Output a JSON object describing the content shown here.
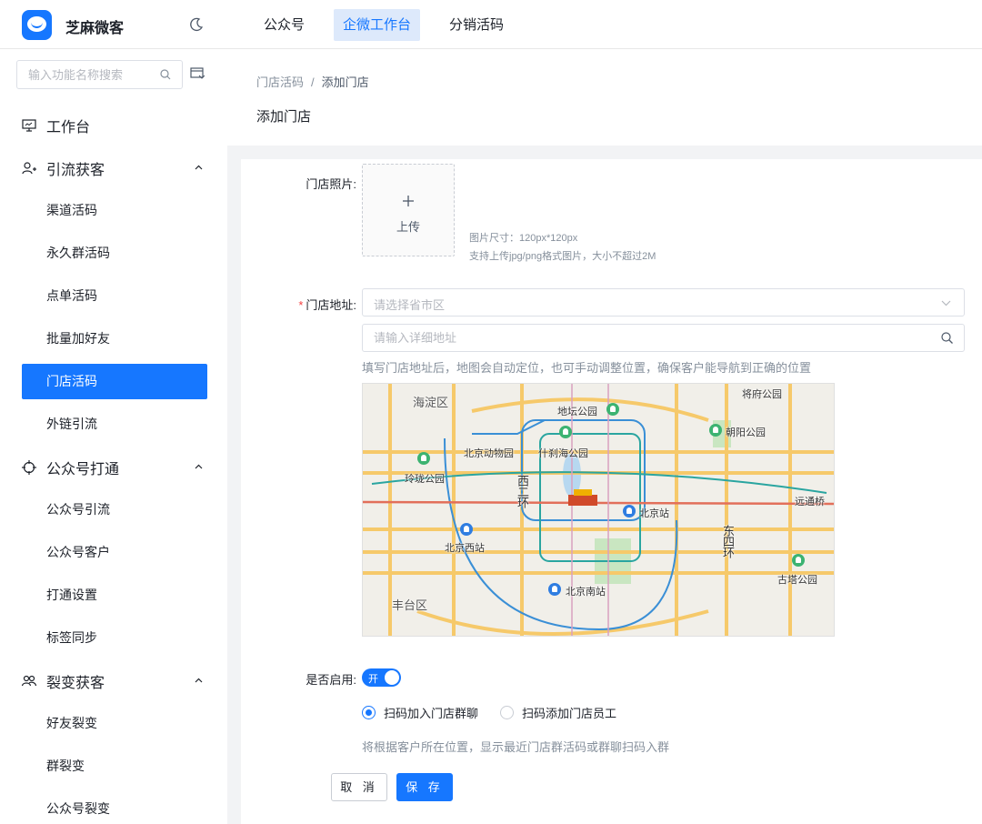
{
  "app": {
    "brand": "芝麻微客"
  },
  "topnav": [
    {
      "label": "公众号"
    },
    {
      "label": "企微工作台"
    },
    {
      "label": "分销活码"
    }
  ],
  "sidebar": {
    "search_placeholder": "输入功能名称搜索",
    "workbench": "工作台",
    "groups": [
      {
        "label": "引流获客",
        "items": [
          "渠道活码",
          "永久群活码",
          "点单活码",
          "批量加好友",
          "门店活码",
          "外链引流"
        ]
      },
      {
        "label": "公众号打通",
        "items": [
          "公众号引流",
          "公众号客户",
          "打通设置",
          "标签同步"
        ]
      },
      {
        "label": "裂变获客",
        "items": [
          "好友裂变",
          "群裂变",
          "公众号裂变"
        ]
      }
    ],
    "active_item": "门店活码"
  },
  "header": {
    "breadcrumb": [
      "门店活码",
      "添加门店"
    ],
    "title": "添加门店"
  },
  "form": {
    "photo_label": "门店照片:",
    "upload_text": "上传",
    "photo_hint_1": "图片尺寸：120px*120px",
    "photo_hint_2": "支持上传jpg/png格式图片，大小不超过2M",
    "address_label": "门店地址:",
    "region_placeholder": "请选择省市区",
    "detail_placeholder": "请输入详细地址",
    "address_hint": "填写门店地址后，地图会自动定位，也可手动调整位置，确保客户能导航到正确的位置",
    "enable_label": "是否启用:",
    "switch_text": "开",
    "switch_on": true,
    "radio_options": [
      "扫码加入门店群聊",
      "扫码添加门店员工"
    ],
    "radio_selected": 0,
    "radio_hint": "将根据客户所在位置，显示最近门店群活码或群聊扫码入群",
    "cancel_label": "取 消",
    "save_label": "保 存"
  },
  "map": {
    "labels": {
      "haidian": "海淀区",
      "ditan": "地坛公园",
      "jiangfu": "将府公园",
      "chaoyang": "朝阳公园",
      "zoo": "北京动物园",
      "shichahai": "什刹海公园",
      "linglong": "玲珑公园",
      "west2": "西二环",
      "beijing_station": "北京站",
      "tongqiao": "远通桥",
      "beijing_west": "北京西站",
      "east4": "东四环",
      "gutai": "古塔公园",
      "fengtai": "丰台区",
      "beijing_south": "北京南站"
    }
  }
}
